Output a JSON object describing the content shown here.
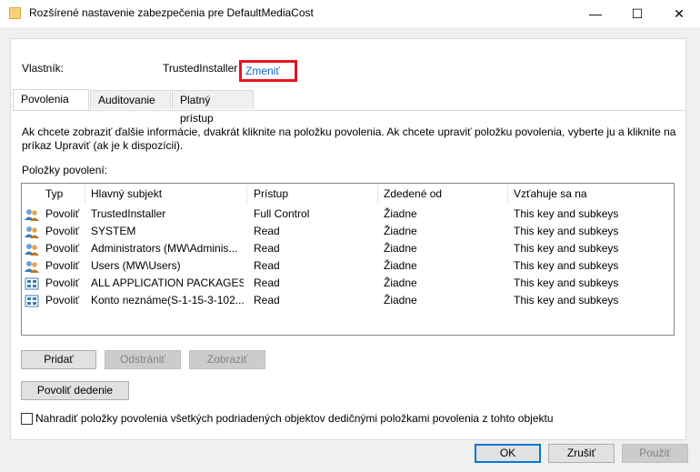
{
  "window": {
    "title": "Rozšírené nastavenie zabezpečenia pre DefaultMediaCost",
    "minimize": "—",
    "maximize": "☐",
    "close": "✕"
  },
  "owner": {
    "label": "Vlastník:",
    "value": "TrustedInstaller",
    "change_link": "Zmeniť"
  },
  "tabs": [
    {
      "label": "Povolenia"
    },
    {
      "label": "Auditovanie"
    },
    {
      "label": "Platný prístup"
    }
  ],
  "info_text": "Ak chcete zobraziť ďalšie informácie, dvakrát kliknite na položku povolenia. Ak chcete upraviť položku povolenia, vyberte ju a kliknite na príkaz Upraviť (ak je k dispozícii).",
  "entries_label": "Položky povolení:",
  "columns": [
    "Typ",
    "Hlavný subjekt",
    "Prístup",
    "Zdedené od",
    "Vzťahuje sa na"
  ],
  "rows": [
    {
      "icon": "users-icon",
      "type": "Povoliť",
      "principal": "TrustedInstaller",
      "access": "Full Control",
      "inherited": "Žiadne",
      "applies": "This key and subkeys"
    },
    {
      "icon": "users-icon",
      "type": "Povoliť",
      "principal": "SYSTEM",
      "access": "Read",
      "inherited": "Žiadne",
      "applies": "This key and subkeys"
    },
    {
      "icon": "users-icon",
      "type": "Povoliť",
      "principal": "Administrators (MW\\Adminis...",
      "access": "Read",
      "inherited": "Žiadne",
      "applies": "This key and subkeys"
    },
    {
      "icon": "users-icon",
      "type": "Povoliť",
      "principal": "Users (MW\\Users)",
      "access": "Read",
      "inherited": "Žiadne",
      "applies": "This key and subkeys"
    },
    {
      "icon": "package-icon",
      "type": "Povoliť",
      "principal": "ALL APPLICATION PACKAGES",
      "access": "Read",
      "inherited": "Žiadne",
      "applies": "This key and subkeys"
    },
    {
      "icon": "package-icon",
      "type": "Povoliť",
      "principal": "Konto neznáme(S-1-15-3-102...",
      "access": "Read",
      "inherited": "Žiadne",
      "applies": "This key and subkeys"
    }
  ],
  "buttons": {
    "add": "Pridať",
    "remove": "Odstrániť",
    "view": "Zobraziť",
    "enable_inheritance": "Povoliť dedenie"
  },
  "replace_checkbox": {
    "label": "Nahradiť položky povolenia všetkých podriadených objektov dedičnými položkami povolenia z tohto objektu",
    "checked": false
  },
  "footer": {
    "ok": "OK",
    "cancel": "Zrušiť",
    "apply": "Použiť"
  },
  "colors": {
    "link": "#0b64c8",
    "highlight": "#e8131e",
    "accent": "#0078d7"
  }
}
